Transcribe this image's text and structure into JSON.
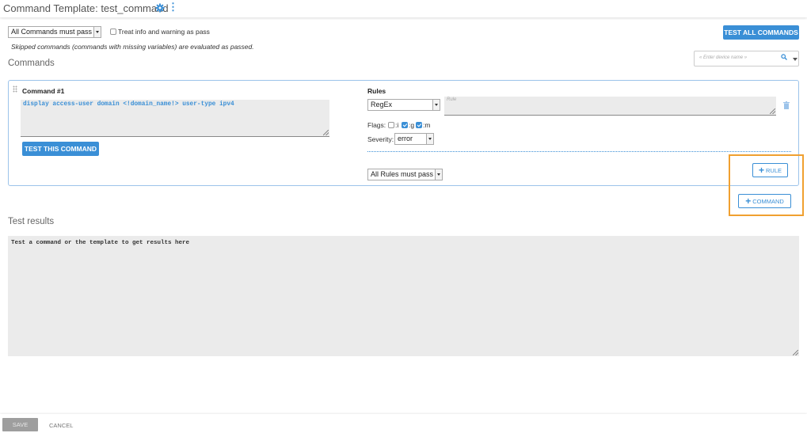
{
  "header": {
    "title": "Command Template: test_command",
    "settings_icon": "gear-icon",
    "more_icon": "kebab-menu-icon",
    "kebab_glyph": "⋮"
  },
  "options": {
    "pass_mode_select": "All Commands must pass",
    "treat_info_label": "Treat info and warning as pass",
    "treat_info_checked": false,
    "skipped_note": "Skipped commands (commands with missing variables) are evaluated as passed."
  },
  "toolbar": {
    "test_all_label": "TEST ALL COMMANDS"
  },
  "commands_section": {
    "title": "Commands",
    "device_placeholder": "« Enter device name »"
  },
  "command": {
    "title": "Command #1",
    "text": "display access-user domain <!domain_name!> user-type ipv4",
    "test_button": "TEST THIS COMMAND",
    "rules": {
      "label": "Rules",
      "type_select": "RegEx",
      "rule_placeholder": "Rule",
      "flags_label": "Flags:",
      "flags": [
        {
          "label": ":i",
          "checked": false
        },
        {
          "label": ":g",
          "checked": true
        },
        {
          "label": ":m",
          "checked": true
        }
      ],
      "severity_label": "Severity:",
      "severity_select": "error",
      "rules_mode_select": "All Rules must pass"
    }
  },
  "buttons": {
    "add_rule": "RULE",
    "add_command": "COMMAND",
    "plus_glyph": "+"
  },
  "results": {
    "title": "Test results",
    "placeholder": "Test a command or the template to get results here"
  },
  "footer": {
    "save": "SAVE",
    "cancel": "CANCEL"
  },
  "colors": {
    "accent": "#3a8fd6",
    "highlight": "#f0a030"
  }
}
